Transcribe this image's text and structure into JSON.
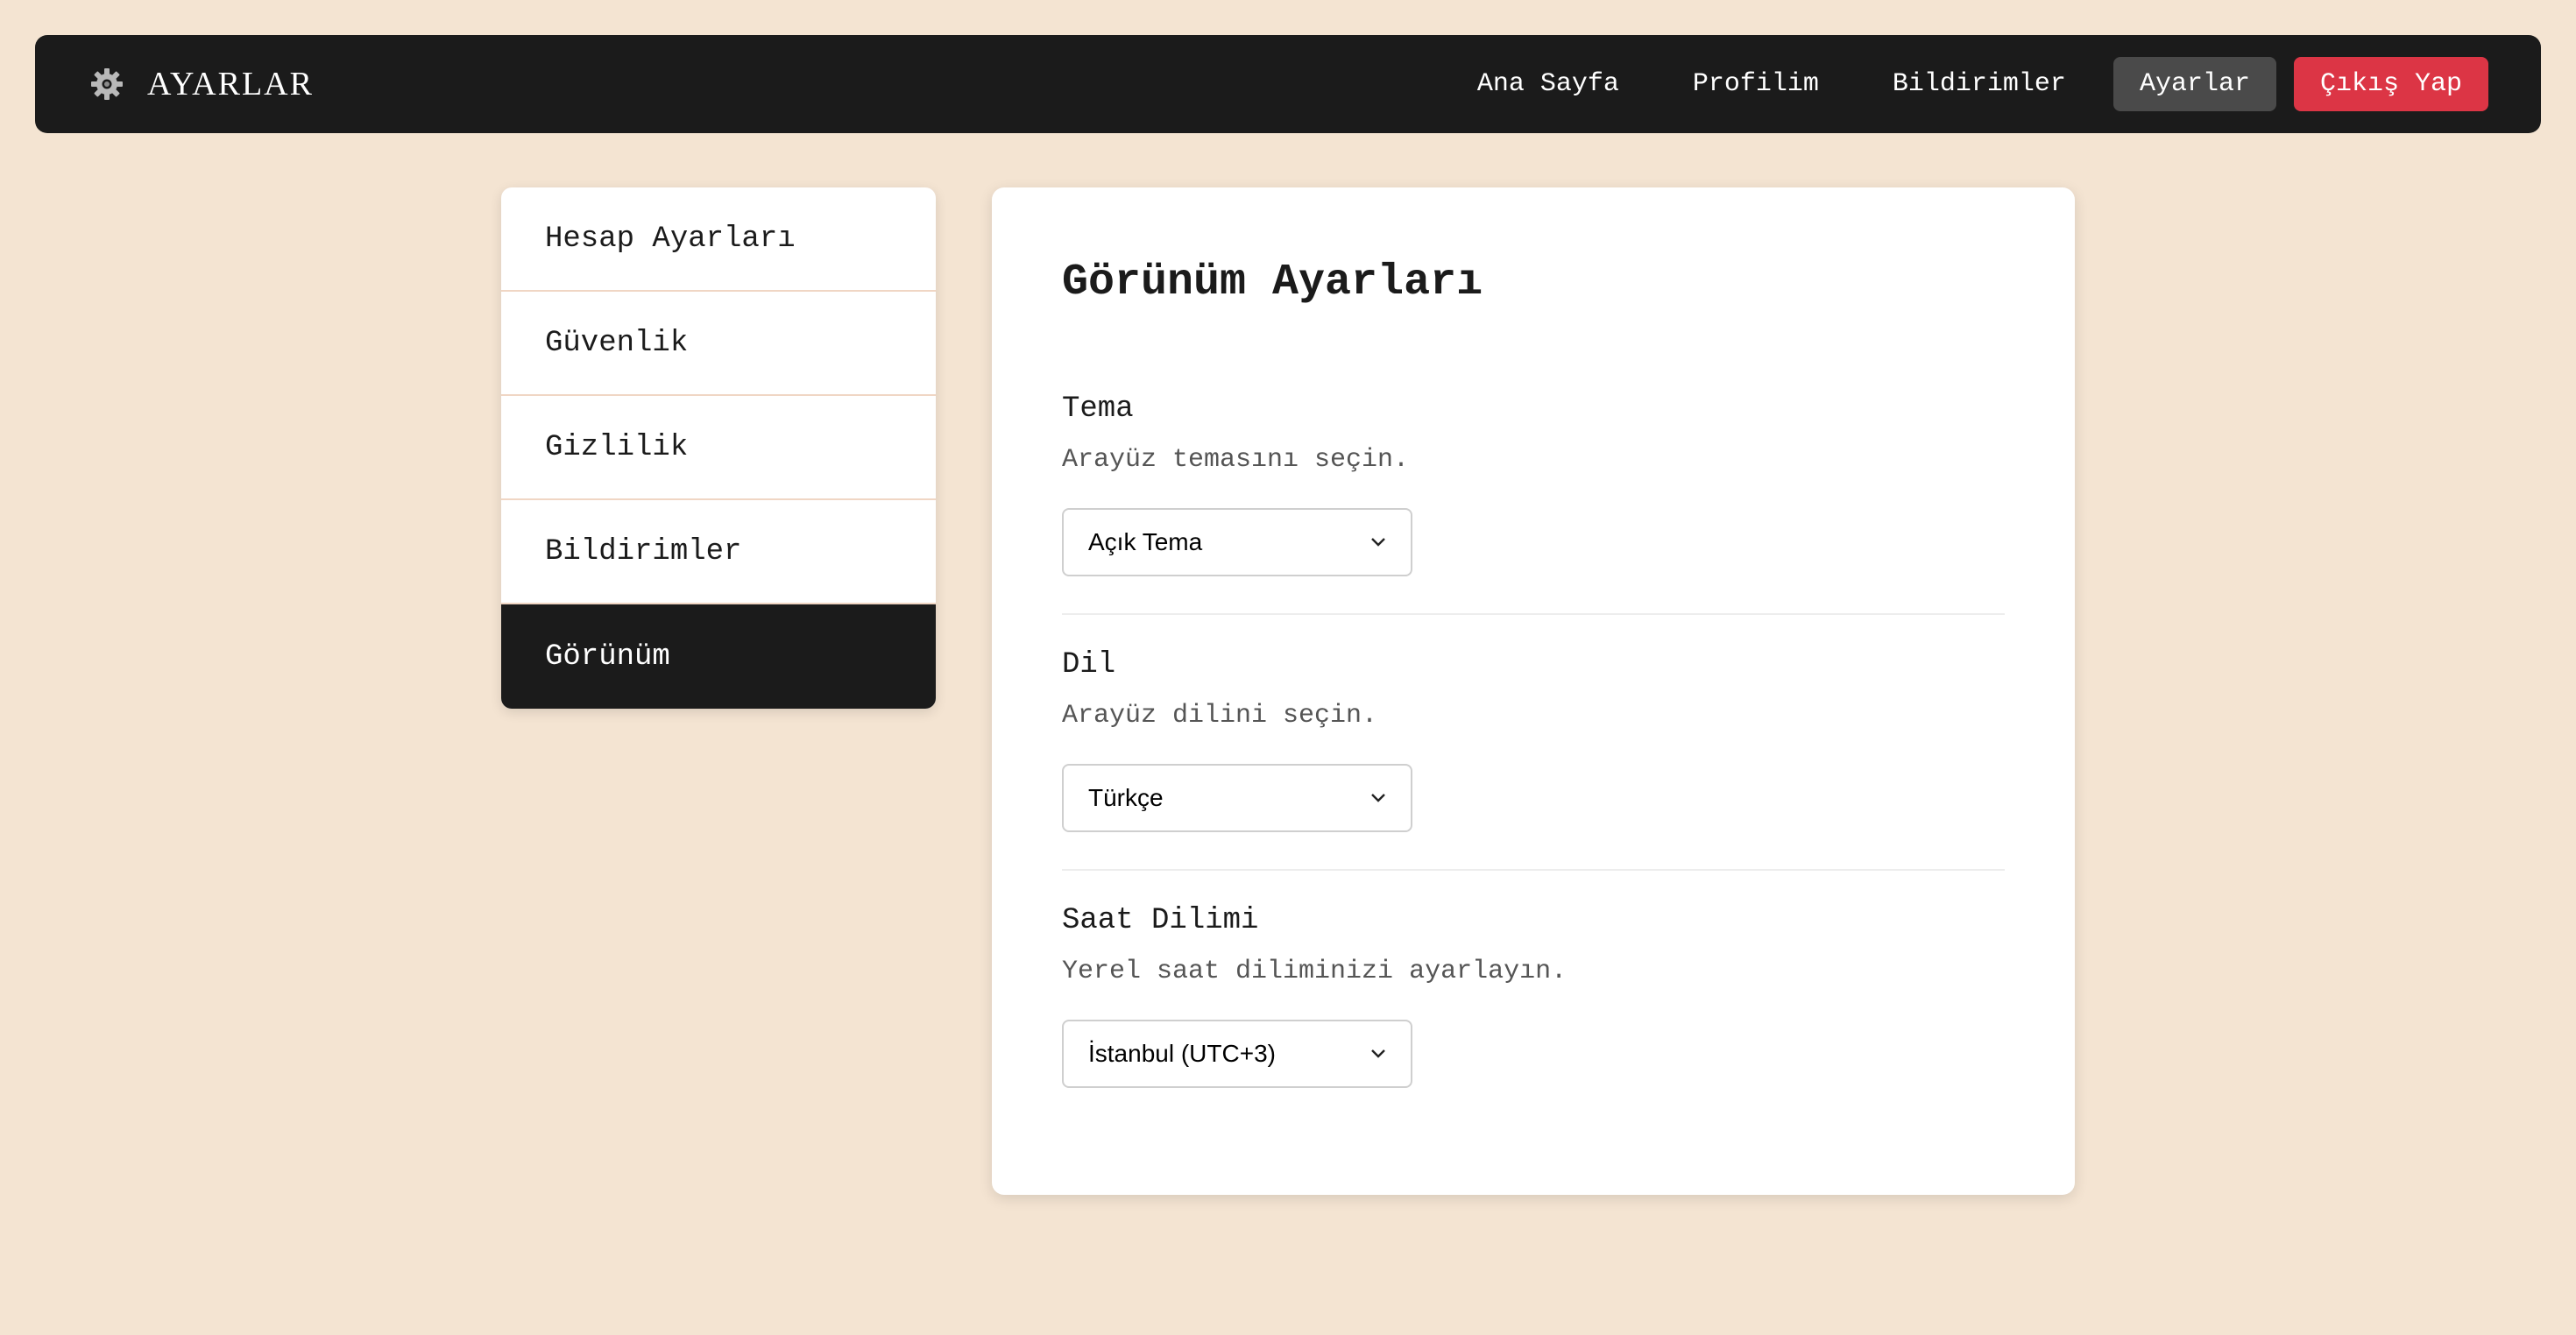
{
  "header": {
    "brand_icon": "gear-icon",
    "brand_title": "AYARLAR",
    "nav": {
      "home": "Ana Sayfa",
      "profile": "Profilim",
      "notifications": "Bildirimler",
      "settings": "Ayarlar",
      "logout": "Çıkış Yap"
    }
  },
  "sidebar": {
    "items": [
      {
        "label": "Hesap Ayarları"
      },
      {
        "label": "Güvenlik"
      },
      {
        "label": "Gizlilik"
      },
      {
        "label": "Bildirimler"
      },
      {
        "label": "Görünüm",
        "active": true
      }
    ]
  },
  "main": {
    "title": "Görünüm Ayarları",
    "settings": [
      {
        "label": "Tema",
        "description": "Arayüz temasını seçin.",
        "value": "Açık Tema"
      },
      {
        "label": "Dil",
        "description": "Arayüz dilini seçin.",
        "value": "Türkçe"
      },
      {
        "label": "Saat Dilimi",
        "description": "Yerel saat diliminizi ayarlayın.",
        "value": "İstanbul (UTC+3)"
      }
    ]
  },
  "colors": {
    "background": "#f4e4d2",
    "navbar": "#1b1b1b",
    "active_nav": "#4a4a4a",
    "logout": "#dc3545",
    "card": "#ffffff"
  }
}
